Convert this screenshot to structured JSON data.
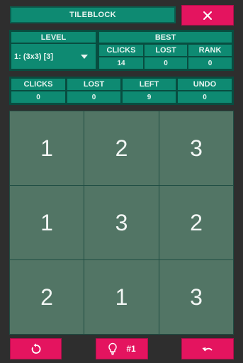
{
  "app": {
    "title": "TILEBLOCK"
  },
  "level": {
    "label": "LEVEL",
    "selected": "1: (3x3) [3]"
  },
  "best": {
    "label": "BEST",
    "clicks_label": "CLICKS",
    "clicks_value": "14",
    "lost_label": "LOST",
    "lost_value": "0",
    "rank_label": "RANK",
    "rank_value": "0"
  },
  "stats": {
    "clicks_label": "CLICKS",
    "clicks_value": "0",
    "lost_label": "LOST",
    "lost_value": "0",
    "left_label": "LEFT",
    "left_value": "9",
    "undo_label": "UNDO",
    "undo_value": "0"
  },
  "board": {
    "rows": [
      [
        "1",
        "2",
        "3"
      ],
      [
        "1",
        "3",
        "2"
      ],
      [
        "2",
        "1",
        "3"
      ]
    ]
  },
  "controls": {
    "hint_label": "#1",
    "icons": [
      "close-icon",
      "restart-icon",
      "lightbulb-icon",
      "undo-icon",
      "dropdown-arrow-icon"
    ]
  },
  "colors": {
    "background": "#2e2e2e",
    "teal": "#0e8a72",
    "teal_dark": "#084d40",
    "tile": "#527565",
    "accent": "#e4145f"
  }
}
